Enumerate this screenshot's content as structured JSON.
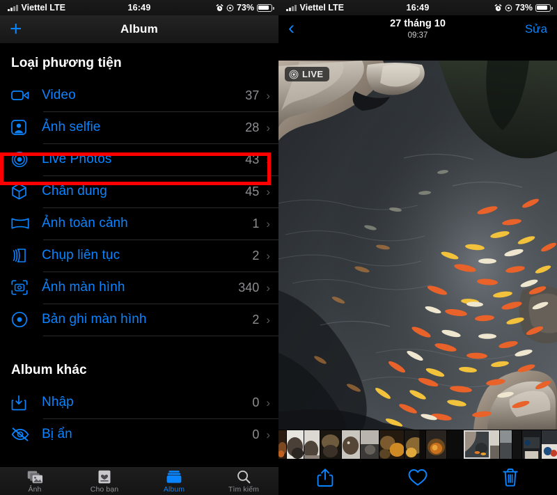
{
  "status_bar": {
    "carrier": "Viettel LTE",
    "time": "16:49",
    "battery_percent": "73%",
    "alarm_icon": "alarm-clock-icon",
    "location_icon": "location-target-icon",
    "signal_icon": "cellular-bars-icon",
    "battery_icon": "battery-icon"
  },
  "colors": {
    "accent_blue": "#0a84ff",
    "annotation_red": "#ff0000",
    "secondary_gray": "#8e8e93",
    "background": "#000000",
    "separator": "#2a2a2c"
  },
  "left_pane": {
    "nav": {
      "add_label": "+",
      "title": "Album"
    },
    "sections": [
      {
        "title": "Loại phương tiện",
        "items": [
          {
            "icon": "video-camera-icon",
            "label": "Video",
            "count": "37",
            "highlighted": false
          },
          {
            "icon": "selfie-person-icon",
            "label": "Ảnh selfie",
            "count": "28",
            "highlighted": false
          },
          {
            "icon": "live-photos-icon",
            "label": "Live Photos",
            "count": "43",
            "highlighted": true
          },
          {
            "icon": "portrait-cube-icon",
            "label": "Chân dung",
            "count": "45",
            "highlighted": false
          },
          {
            "icon": "panorama-icon",
            "label": "Ảnh toàn cảnh",
            "count": "1",
            "highlighted": false
          },
          {
            "icon": "burst-layers-icon",
            "label": "Chụp liên tục",
            "count": "2",
            "highlighted": false
          },
          {
            "icon": "screenshot-icon",
            "label": "Ảnh màn hình",
            "count": "340",
            "highlighted": false
          },
          {
            "icon": "screen-recording-icon",
            "label": "Bản ghi màn hình",
            "count": "2",
            "highlighted": false
          }
        ]
      },
      {
        "title": "Album khác",
        "items": [
          {
            "icon": "import-icon",
            "label": "Nhập",
            "count": "0",
            "highlighted": false
          },
          {
            "icon": "hidden-eye-icon",
            "label": "Bị ẩn",
            "count": "0",
            "highlighted": false
          }
        ]
      }
    ],
    "tab_bar": [
      {
        "icon": "photos-icon",
        "label": "Ảnh",
        "active": false
      },
      {
        "icon": "for-you-icon",
        "label": "Cho bạn",
        "active": false
      },
      {
        "icon": "albums-icon",
        "label": "Album",
        "active": true
      },
      {
        "icon": "search-icon",
        "label": "Tìm kiếm",
        "active": false
      }
    ]
  },
  "right_pane": {
    "nav": {
      "back_label": "‹",
      "date": "27 tháng 10",
      "time": "09:37",
      "edit_label": "Sửa"
    },
    "photo": {
      "live_badge_label": "LIVE",
      "live_badge_icon": "live-photos-icon",
      "description": "koi-pond-photo"
    },
    "toolbar": [
      {
        "icon": "share-icon",
        "name": "share-button"
      },
      {
        "icon": "heart-icon",
        "name": "favorite-button"
      },
      {
        "icon": "trash-icon",
        "name": "delete-button"
      }
    ]
  }
}
